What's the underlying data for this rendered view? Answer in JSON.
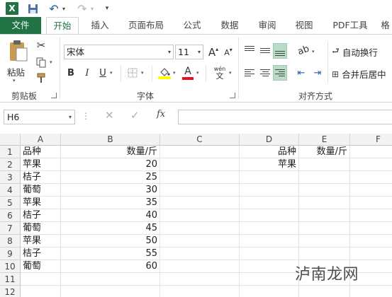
{
  "app": {
    "logo_letter": "X"
  },
  "tabs": {
    "file": "文件",
    "items": [
      "开始",
      "插入",
      "页面布局",
      "公式",
      "数据",
      "审阅",
      "视图",
      "PDF工具",
      "格"
    ]
  },
  "ribbon": {
    "clipboard": {
      "paste": "粘贴",
      "label": "剪贴板"
    },
    "font": {
      "name": "宋体",
      "size": "11",
      "bold": "B",
      "italic": "I",
      "underline": "U",
      "grow": "A",
      "shrink": "A",
      "phonetic_top": "wén",
      "phonetic_bottom": "文",
      "label": "字体",
      "fill_color": "#ffff00",
      "font_color": "#e81123"
    },
    "alignment": {
      "wrap_text": "自动换行",
      "merge_center": "合并后居中",
      "label": "对齐方式"
    }
  },
  "formula_bar": {
    "name_box": "H6",
    "dots": "⋮",
    "cancel": "✕",
    "enter": "✓",
    "fx": "fx",
    "value": ""
  },
  "sheet": {
    "columns": [
      "A",
      "B",
      "C",
      "D",
      "E",
      "F"
    ],
    "rows": [
      "1",
      "2",
      "3",
      "4",
      "5",
      "6",
      "7",
      "8",
      "9",
      "10",
      "11",
      "12"
    ],
    "cells": {
      "A1": "品种",
      "B1": "数量/斤",
      "A2": "苹果",
      "B2": "20",
      "A3": "桔子",
      "B3": "25",
      "A4": "葡萄",
      "B4": "30",
      "A5": "苹果",
      "B5": "35",
      "A6": "桔子",
      "B6": "40",
      "A7": "葡萄",
      "B7": "45",
      "A8": "苹果",
      "B8": "50",
      "A9": "桔子",
      "B9": "55",
      "A10": "葡萄",
      "B10": "60",
      "D1": "品种",
      "E1": "数量/斤",
      "D2": "苹果"
    }
  },
  "watermark": "泸南龙网"
}
